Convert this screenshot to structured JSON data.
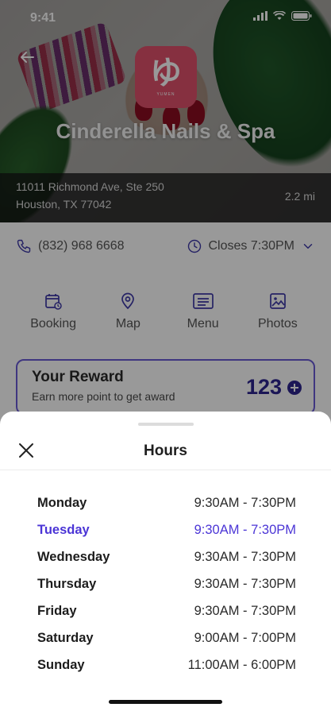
{
  "status_bar": {
    "time": "9:41"
  },
  "store": {
    "name": "Cinderella Nails & Spa",
    "address_line1": "11011 Richmond Ave, Ste 250",
    "address_line2": "Houston, TX 77042",
    "distance": "2.2 mi",
    "phone": "(832) 968 6668",
    "hours_status": "Closes 7:30PM",
    "logo_mark": "ゆ",
    "logo_sub": "YUMEN"
  },
  "actions": [
    {
      "label": "Booking",
      "icon": "calendar-icon"
    },
    {
      "label": "Map",
      "icon": "map-pin-icon"
    },
    {
      "label": "Menu",
      "icon": "menu-list-icon"
    },
    {
      "label": "Photos",
      "icon": "photo-icon"
    }
  ],
  "reward": {
    "title": "Your Reward",
    "subtitle": "Earn more point to get award",
    "points": "123"
  },
  "sheet": {
    "title": "Hours",
    "hours": [
      {
        "day": "Monday",
        "time": "9:30AM - 7:30PM",
        "active": false
      },
      {
        "day": "Tuesday",
        "time": "9:30AM - 7:30PM",
        "active": true
      },
      {
        "day": "Wednesday",
        "time": "9:30AM - 7:30PM",
        "active": false
      },
      {
        "day": "Thursday",
        "time": "9:30AM - 7:30PM",
        "active": false
      },
      {
        "day": "Friday",
        "time": "9:30AM - 7:30PM",
        "active": false
      },
      {
        "day": "Saturday",
        "time": "9:00AM - 7:00PM",
        "active": false
      },
      {
        "day": "Sunday",
        "time": "11:00AM - 6:00PM",
        "active": false
      }
    ]
  },
  "colors": {
    "accent": "#4b35d6",
    "reward_border": "#6a5bd6",
    "logo_bg": "#e0506b"
  }
}
